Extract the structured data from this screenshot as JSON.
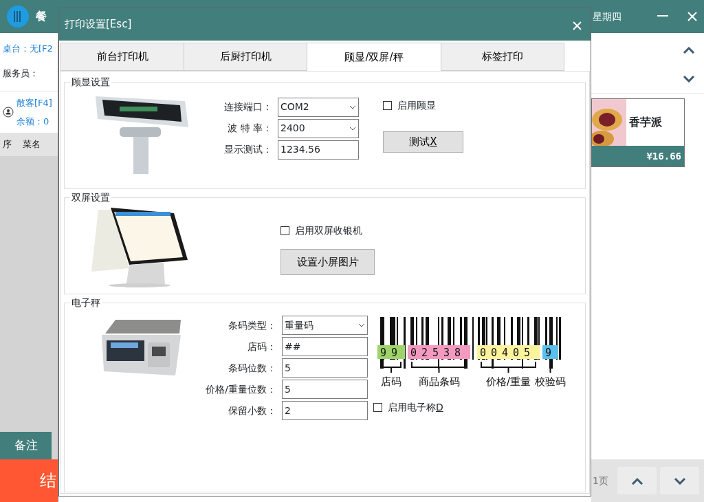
{
  "app": {
    "title": "餐",
    "weekday": "星期四"
  },
  "left_panel": {
    "table": "桌台：无[F2",
    "waiter": "服务员：",
    "customer": "散客[F4]",
    "balance": "余额：0",
    "columns": [
      "序",
      "菜名"
    ],
    "note_button": "备注",
    "checkout_button": "结"
  },
  "right_panel": {
    "product": {
      "name": "香芋派",
      "price": "¥16.66"
    },
    "page": "1页"
  },
  "dialog": {
    "title": "打印设置[Esc]",
    "tabs": [
      {
        "label": "前台打印机",
        "selected": false
      },
      {
        "label": "后厨打印机",
        "selected": false
      },
      {
        "label": "顾显/双屏/秤",
        "selected": true
      },
      {
        "label": "标签打印",
        "selected": false
      }
    ],
    "display": {
      "title": "顾显设置",
      "fields": [
        {
          "label": "连接端口：",
          "kind": "select",
          "value": "COM2"
        },
        {
          "label": "波 特 率：",
          "kind": "select",
          "value": "2400"
        },
        {
          "label": "显示测试：",
          "kind": "text",
          "value": "1234.56"
        }
      ],
      "enable": {
        "label": "启用顾显",
        "checked": false
      },
      "button": {
        "label": "测试",
        "access_key": "X"
      }
    },
    "dual_screen": {
      "title": "双屏设置",
      "enable": {
        "label": "启用双屏收银机",
        "checked": false
      },
      "button": {
        "label": "设置小屏图片"
      }
    },
    "scale": {
      "title": "电子秤",
      "fields": [
        {
          "label": "条码类型：",
          "kind": "select",
          "value": "重量码"
        },
        {
          "label": "店码：",
          "kind": "text",
          "value": "##"
        },
        {
          "label": "条码位数：",
          "kind": "text",
          "value": "5"
        },
        {
          "label": "价格/重量位数：",
          "kind": "text",
          "value": "5"
        },
        {
          "label": "保留小数：",
          "kind": "text",
          "value": "2"
        }
      ],
      "barcode": [
        {
          "digits": "99",
          "color": "#9ed36a",
          "label": "店码"
        },
        {
          "digits": "02538",
          "color": "#f49ac1",
          "label": "商品条码"
        },
        {
          "digits": "00405",
          "color": "#fbf49c",
          "label": "价格/重量"
        },
        {
          "digits": "9",
          "color": "#5bc0eb",
          "label": "校验码"
        }
      ],
      "enable": {
        "label": "启用电子称",
        "access_key": "D",
        "checked": false
      }
    }
  }
}
